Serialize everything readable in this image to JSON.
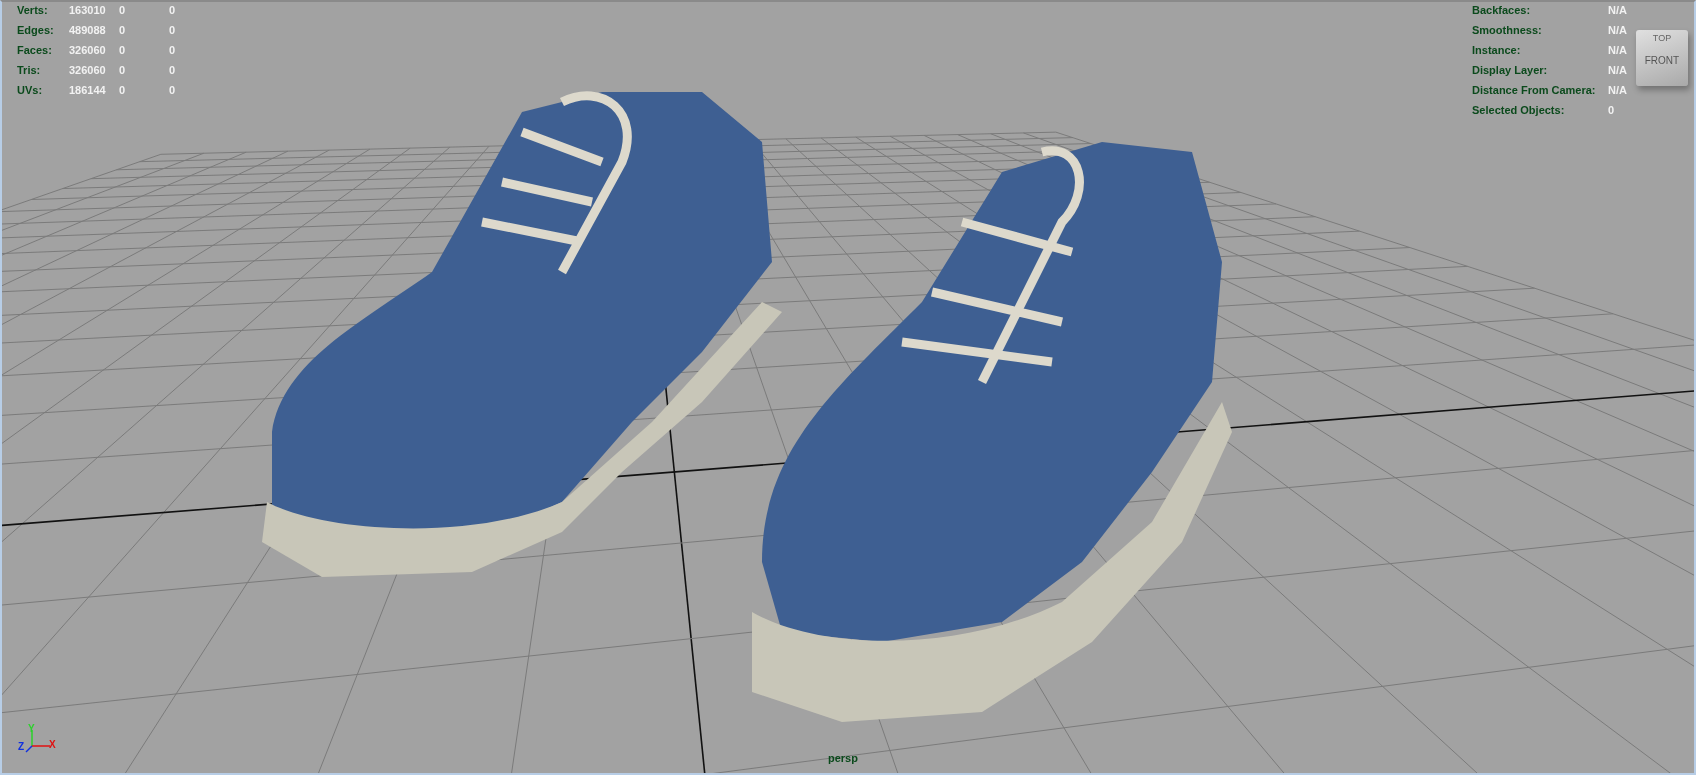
{
  "stats": [
    {
      "label": "Verts:",
      "values": [
        "163010",
        "0",
        "0"
      ]
    },
    {
      "label": "Edges:",
      "values": [
        "489088",
        "0",
        "0"
      ]
    },
    {
      "label": "Faces:",
      "values": [
        "326060",
        "0",
        "0"
      ]
    },
    {
      "label": "Tris:",
      "values": [
        "326060",
        "0",
        "0"
      ]
    },
    {
      "label": "UVs:",
      "values": [
        "186144",
        "0",
        "0"
      ]
    }
  ],
  "info": [
    {
      "label": "Backfaces:",
      "value": "N/A"
    },
    {
      "label": "Smoothness:",
      "value": "N/A"
    },
    {
      "label": "Instance:",
      "value": "N/A"
    },
    {
      "label": "Display Layer:",
      "value": "N/A"
    },
    {
      "label": "Distance From Camera:",
      "value": "N/A"
    },
    {
      "label": "Selected Objects:",
      "value": "0"
    }
  ],
  "view_cube": {
    "front": "FRONT",
    "top": "TOP"
  },
  "axes": {
    "y": "Y",
    "z": "Z",
    "x": "X"
  },
  "camera": "persp"
}
